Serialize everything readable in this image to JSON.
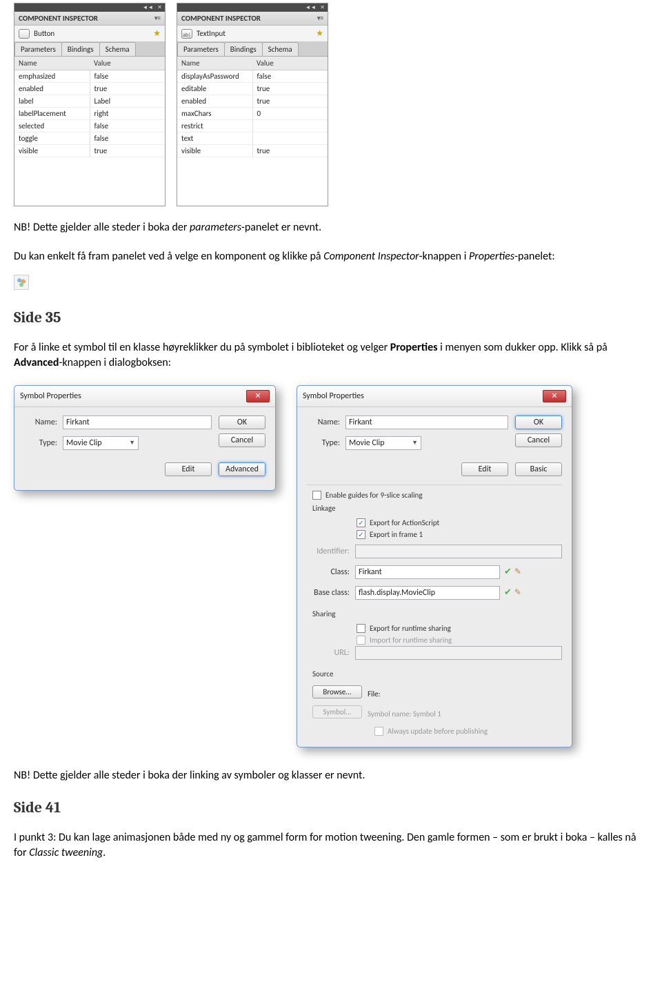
{
  "panel": {
    "title": "COMPONENT INSPECTOR",
    "tabs": [
      "Parameters",
      "Bindings",
      "Schema"
    ],
    "headers": {
      "name": "Name",
      "value": "Value"
    }
  },
  "panel1": {
    "component": "Button",
    "rows": [
      {
        "n": "emphasized",
        "v": "false"
      },
      {
        "n": "enabled",
        "v": "true"
      },
      {
        "n": "label",
        "v": "Label"
      },
      {
        "n": "labelPlacement",
        "v": "right"
      },
      {
        "n": "selected",
        "v": "false"
      },
      {
        "n": "toggle",
        "v": "false"
      },
      {
        "n": "visible",
        "v": "true"
      }
    ]
  },
  "panel2": {
    "component": "TextInput",
    "rows": [
      {
        "n": "displayAsPassword",
        "v": "false"
      },
      {
        "n": "editable",
        "v": "true"
      },
      {
        "n": "enabled",
        "v": "true"
      },
      {
        "n": "maxChars",
        "v": "0"
      },
      {
        "n": "restrict",
        "v": ""
      },
      {
        "n": "text",
        "v": ""
      },
      {
        "n": "visible",
        "v": "true"
      }
    ]
  },
  "text": {
    "p1a": "NB! Dette gjelder alle steder i boka der ",
    "p1b": "parameters",
    "p1c": "-panelet er nevnt.",
    "p2a": "Du kan enkelt få fram panelet ved å velge en komponent og klikke på ",
    "p2b": "Component Inspector",
    "p2c": "-knappen i ",
    "p2d": "Properties",
    "p2e": "-panelet:",
    "side35": "Side 35",
    "p3a": "For å linke et symbol til en klasse høyreklikker du på symbolet i biblioteket og velger ",
    "p3b": "Properties",
    "p3c": " i menyen som dukker opp. Klikk så på ",
    "p3d": "Advanced",
    "p3e": "-knappen i dialogboksen:",
    "p4": "NB! Dette gjelder alle steder i boka der linking av symboler og klasser er nevnt.",
    "side41": "Side 41",
    "p5a": "I punkt 3: Du kan lage animasjonen både med ny og gammel form for motion tweening. Den gamle formen – som er brukt i boka – kalles nå for ",
    "p5b": "Classic tweening",
    "p5c": "."
  },
  "dialog": {
    "title": "Symbol Properties",
    "nameLabel": "Name:",
    "typeLabel": "Type:",
    "nameValue": "Firkant",
    "typeValue": "Movie Clip",
    "ok": "OK",
    "cancel": "Cancel",
    "edit": "Edit",
    "advanced": "Advanced",
    "basic": "Basic",
    "enable9slice": "Enable guides for 9-slice scaling",
    "linkage": "Linkage",
    "exportAS": "Export for ActionScript",
    "exportFrame1": "Export in frame 1",
    "identifier": "Identifier:",
    "classLabel": "Class:",
    "classValue": "Firkant",
    "baseClassLabel": "Base class:",
    "baseClassValue": "flash.display.MovieClip",
    "sharing": "Sharing",
    "exportRuntime": "Export for runtime sharing",
    "importRuntime": "Import for runtime sharing",
    "urlLabel": "URL:",
    "source": "Source",
    "browse": "Browse...",
    "fileLabel": "File:",
    "symbolBtn": "Symbol...",
    "symbolName": "Symbol name: Symbol 1",
    "alwaysUpdate": "Always update before publishing"
  }
}
